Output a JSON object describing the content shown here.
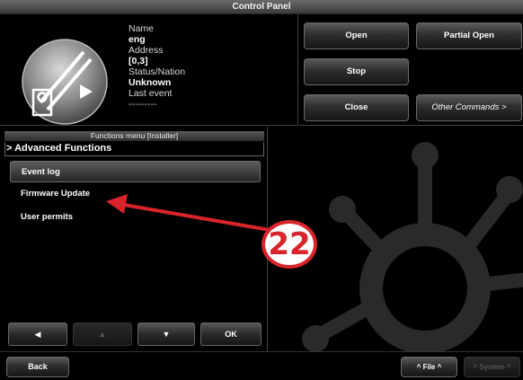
{
  "window": {
    "title": "Control Panel"
  },
  "device": {
    "icon": "gate-barrier-icon",
    "name_label": "Name",
    "name_value": "eng",
    "address_label": "Address",
    "address_value": "[0,3]",
    "status_label": "Status/Nation",
    "status_value": "Unknown",
    "last_event_label": "Last event",
    "last_event_value": "---------"
  },
  "commands": {
    "open": "Open",
    "partial_open": "Partial Open",
    "stop": "Stop",
    "close": "Close",
    "other": "Other Commands >"
  },
  "menu": {
    "header": "Functions menu [Installer]",
    "path": "> Advanced Functions",
    "items": [
      {
        "label": "Event log",
        "selected": true
      },
      {
        "label": "Firmware Update",
        "selected": false
      },
      {
        "label": "User permits",
        "selected": false
      }
    ],
    "nav": {
      "left": "◀",
      "up": "▲",
      "down": "▼",
      "ok": "OK"
    }
  },
  "footer": {
    "back": "Back",
    "file": "^ File ^",
    "system": "^ System ^"
  },
  "annotation": {
    "number": "22",
    "color": "#d8242b"
  },
  "colors": {
    "background": "#000000",
    "button_top": "#5a5a5a",
    "button_bottom": "#161616",
    "accent_red": "#d8242b"
  }
}
